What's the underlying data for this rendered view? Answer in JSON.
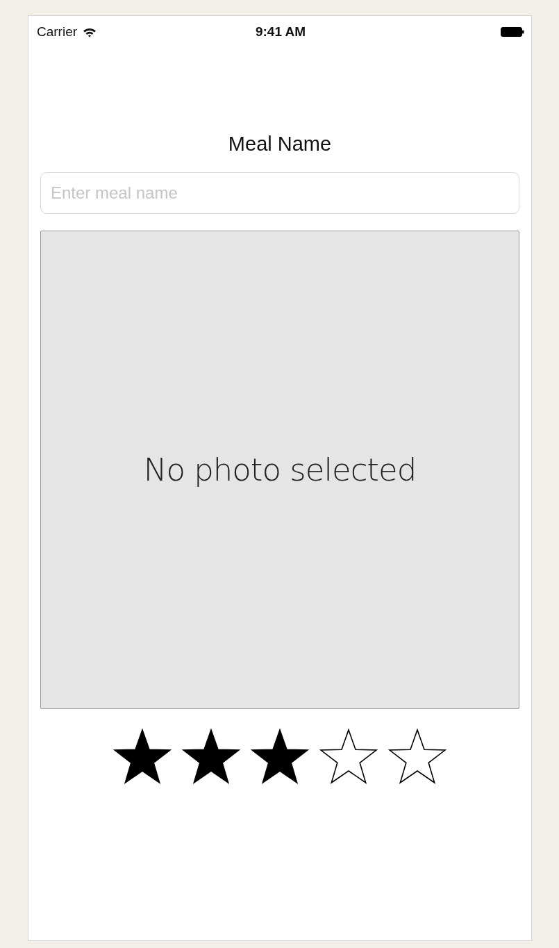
{
  "status_bar": {
    "carrier": "Carrier",
    "time": "9:41 AM"
  },
  "title": "Meal Name",
  "meal_name_field": {
    "placeholder": "Enter meal name"
  },
  "photo": {
    "label": "No photo selected"
  },
  "rating": {
    "stars": 3
  }
}
